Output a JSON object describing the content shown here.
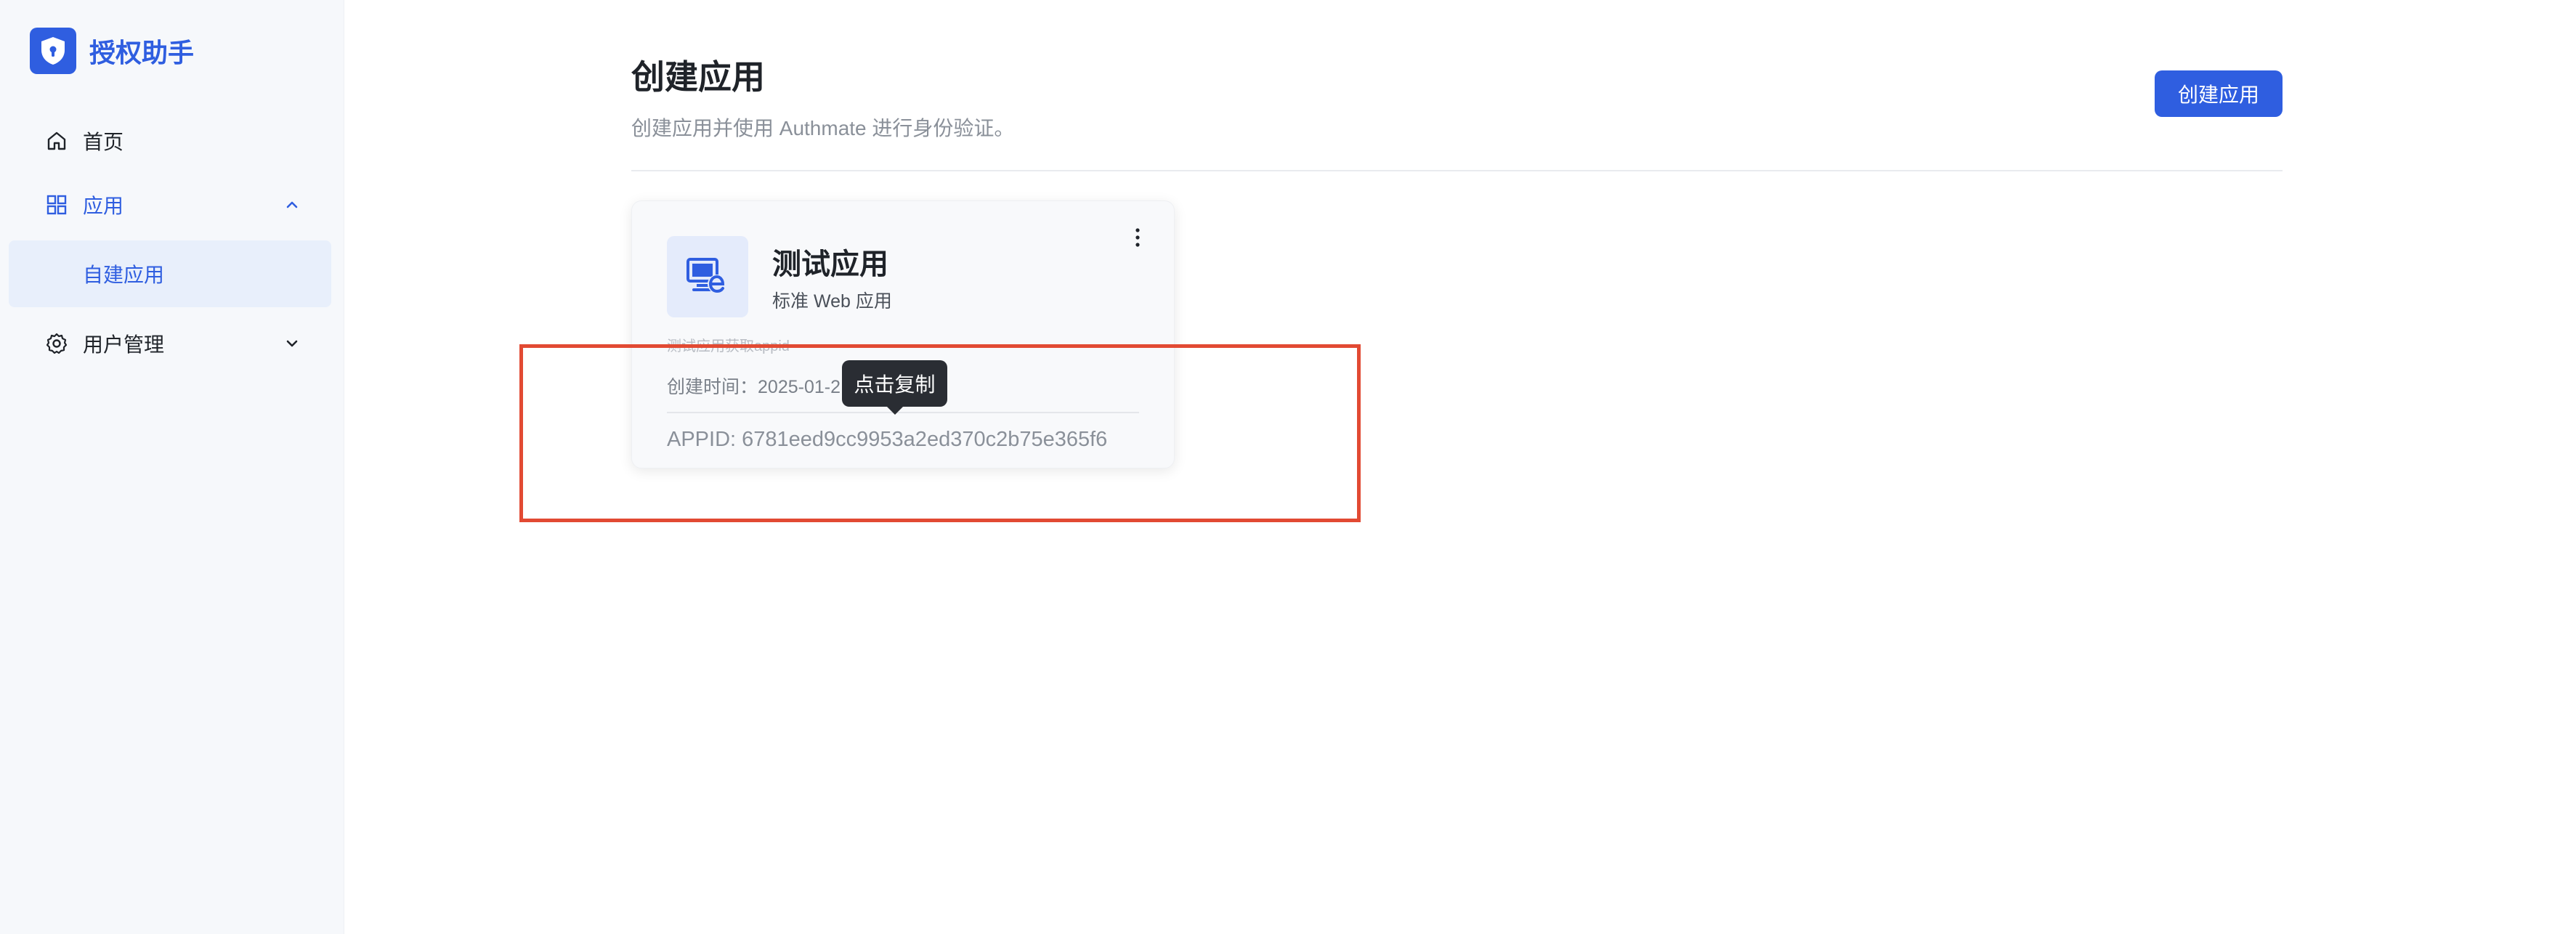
{
  "brand": {
    "name": "授权助手",
    "accent": "#2f5ee0"
  },
  "sidebar": {
    "items": [
      {
        "label": "首页",
        "icon": "home-icon"
      },
      {
        "label": "应用",
        "icon": "grid-icon",
        "expanded": true,
        "active": true
      },
      {
        "label": "自建应用",
        "sub": true,
        "selected": true
      },
      {
        "label": "用户管理",
        "icon": "gear-icon",
        "expanded": false
      }
    ]
  },
  "main": {
    "title": "创建应用",
    "subtitle": "创建应用并使用 Authmate 进行身份验证。",
    "create_button": "创建应用"
  },
  "card": {
    "name": "测试应用",
    "type": "标准 Web 应用",
    "description": "测试应用获取appid",
    "created_label": "创建时间：",
    "created_value": "2025-01-2",
    "appid_text": "APPID: 6781eed9cc9953a2ed370c2b75e365f6",
    "icon": "web-app-icon"
  },
  "tooltip": {
    "text": "点击复制"
  },
  "colors": {
    "primary": "#2f5ee0",
    "highlight": "#e24a33",
    "tooltip_bg": "#2a2d33"
  }
}
